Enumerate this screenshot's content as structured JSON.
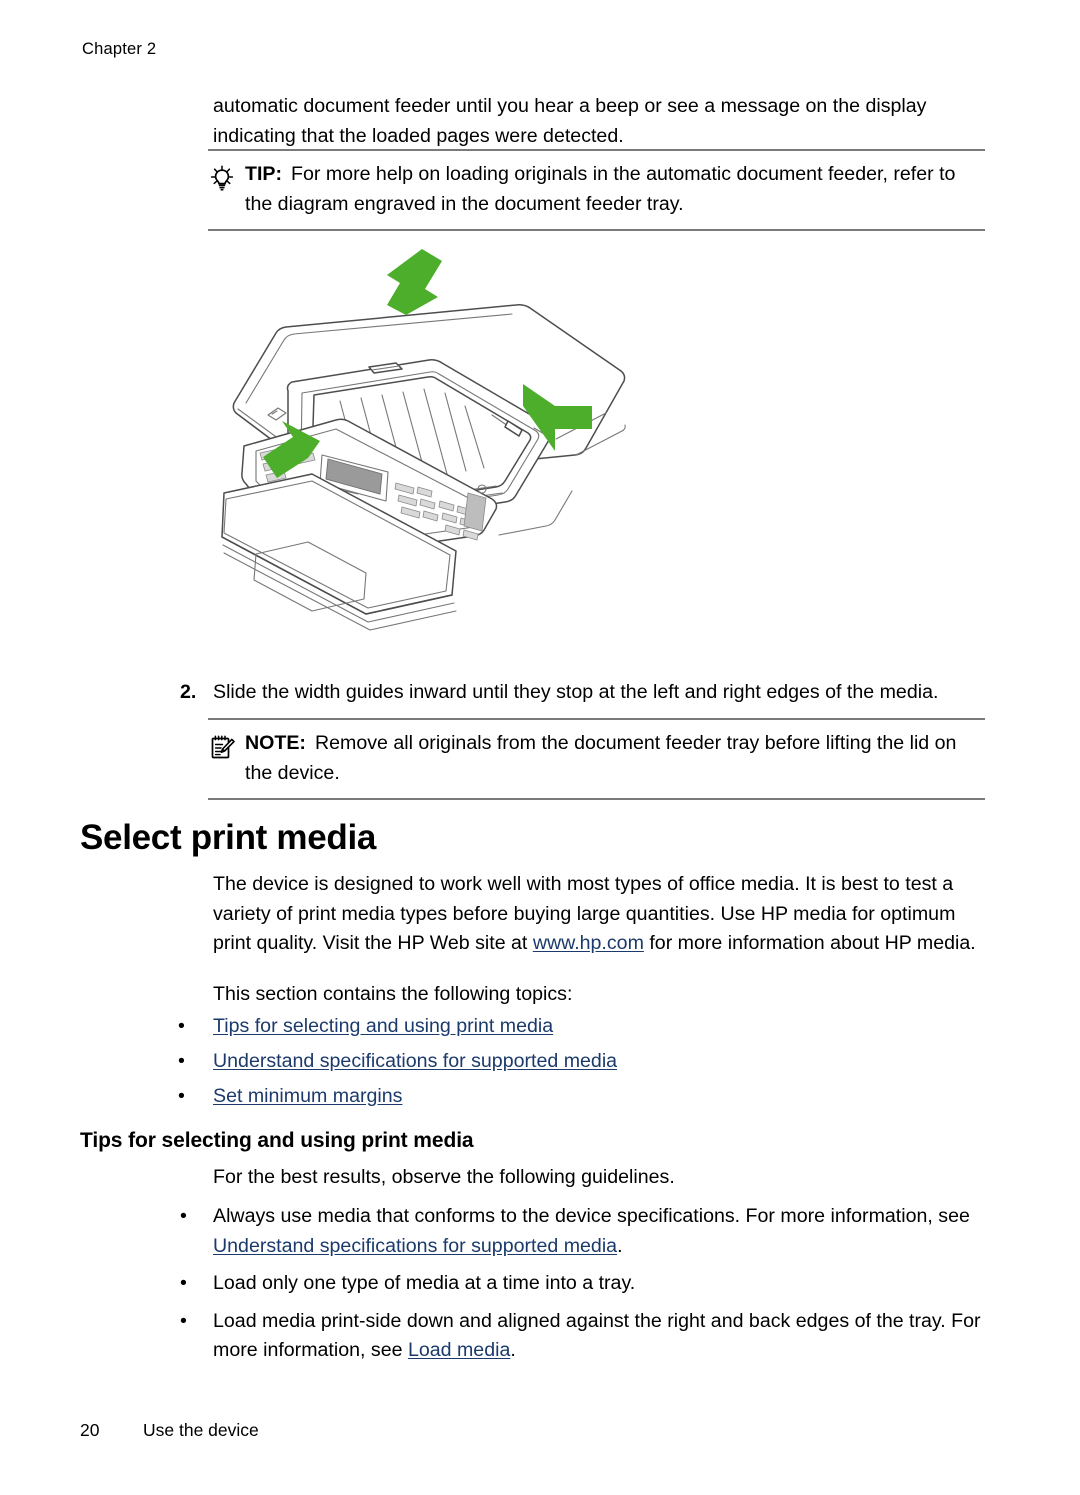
{
  "header": {
    "chapter": "Chapter 2"
  },
  "intro": {
    "paragraph": "automatic document feeder until you hear a beep or see a message on the display indicating that the loaded pages were detected."
  },
  "tip": {
    "icon": "lightbulb-icon",
    "label": "TIP:",
    "text": "For more help on loading originals in the automatic document feeder, refer to the diagram engraved in the document feeder tray."
  },
  "figure": {
    "alt": "Line drawing of an all-in-one printer with the automatic document feeder tray and three green arrows indicating where to slide the width guides and load originals",
    "arrow_color": "#4CAE2B",
    "line_color": "#4d4d4d",
    "screen_color": "#9a9a9a"
  },
  "step2": {
    "number": "2.",
    "text": "Slide the width guides inward until they stop at the left and right edges of the media."
  },
  "note": {
    "icon": "notepad-pencil-icon",
    "label": "NOTE:",
    "text": "Remove all originals from the document feeder tray before lifting the lid on the device."
  },
  "select_print_media": {
    "heading": "Select print media",
    "intro_before_link": "The device is designed to work well with most types of office media. It is best to test a variety of print media types before buying large quantities. Use HP media for optimum print quality. Visit the HP Web site at ",
    "intro_link": "www.hp.com",
    "intro_after_link": " for more information about HP media.",
    "topics_lead": "This section contains the following topics:",
    "topics": [
      "Tips for selecting and using print media",
      "Understand specifications for supported media",
      "Set minimum margins"
    ]
  },
  "tips_section": {
    "heading": "Tips for selecting and using print media",
    "lead": "For the best results, observe the following guidelines.",
    "guidelines": [
      {
        "before_link": "Always use media that conforms to the device specifications. For more information, see ",
        "link": "Understand specifications for supported media",
        "after_link": "."
      },
      {
        "before_link": "Load only one type of media at a time into a tray.",
        "link": "",
        "after_link": ""
      },
      {
        "before_link": "Load media print-side down and aligned against the right and back edges of the tray. For more information, see ",
        "link": "Load media",
        "after_link": "."
      }
    ]
  },
  "bullet_glyph": "•",
  "footer": {
    "page_number": "20",
    "section": "Use the device"
  },
  "colors": {
    "link": "#1b3a6b",
    "rule": "#7a7a7a",
    "text": "#000000",
    "accent_green": "#4CAE2B"
  }
}
